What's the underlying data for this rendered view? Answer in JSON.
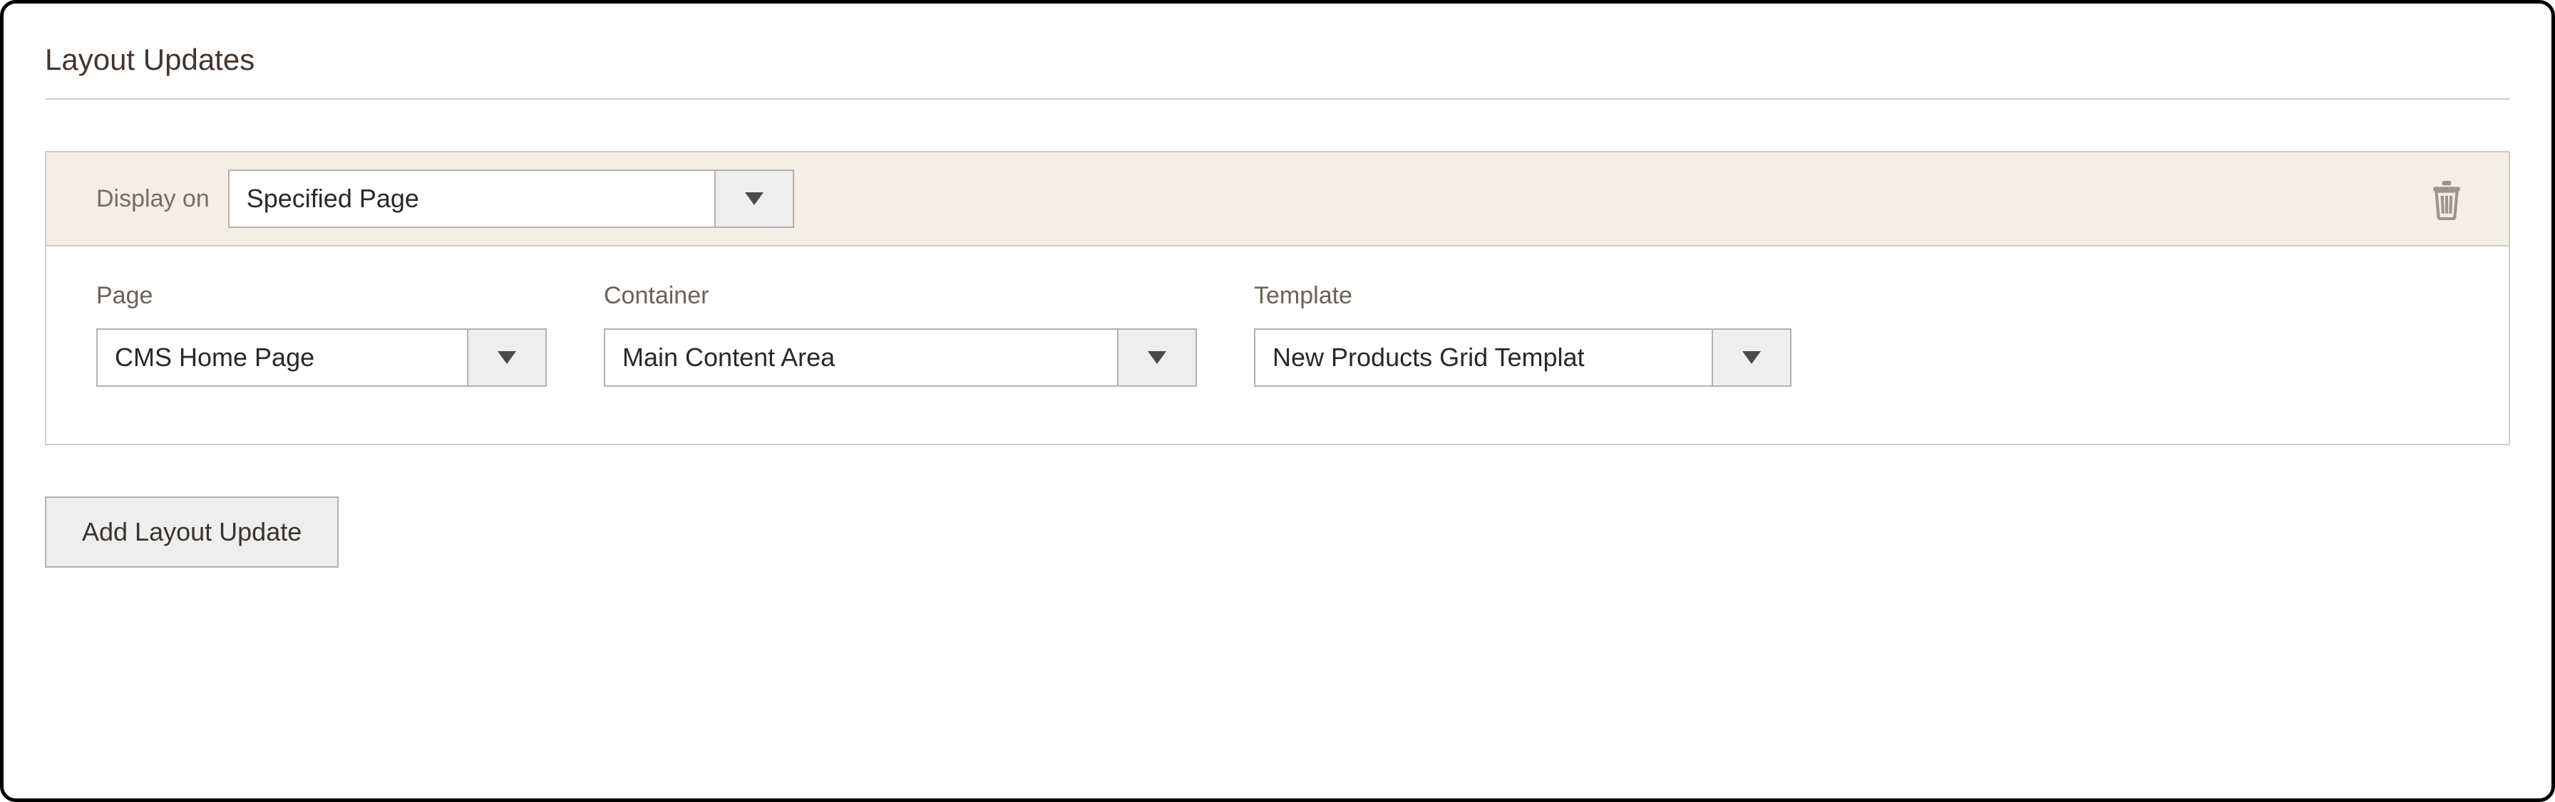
{
  "section": {
    "title": "Layout Updates"
  },
  "update": {
    "display_label": "Display on",
    "display_value": "Specified Page",
    "fields": {
      "page": {
        "label": "Page",
        "value": "CMS Home Page"
      },
      "container": {
        "label": "Container",
        "value": "Main Content Area"
      },
      "template": {
        "label": "Template",
        "value": "New Products Grid Templat"
      }
    }
  },
  "buttons": {
    "add": "Add Layout Update"
  },
  "icons": {
    "trash": "trash-icon",
    "caret": "caret-down-icon"
  }
}
